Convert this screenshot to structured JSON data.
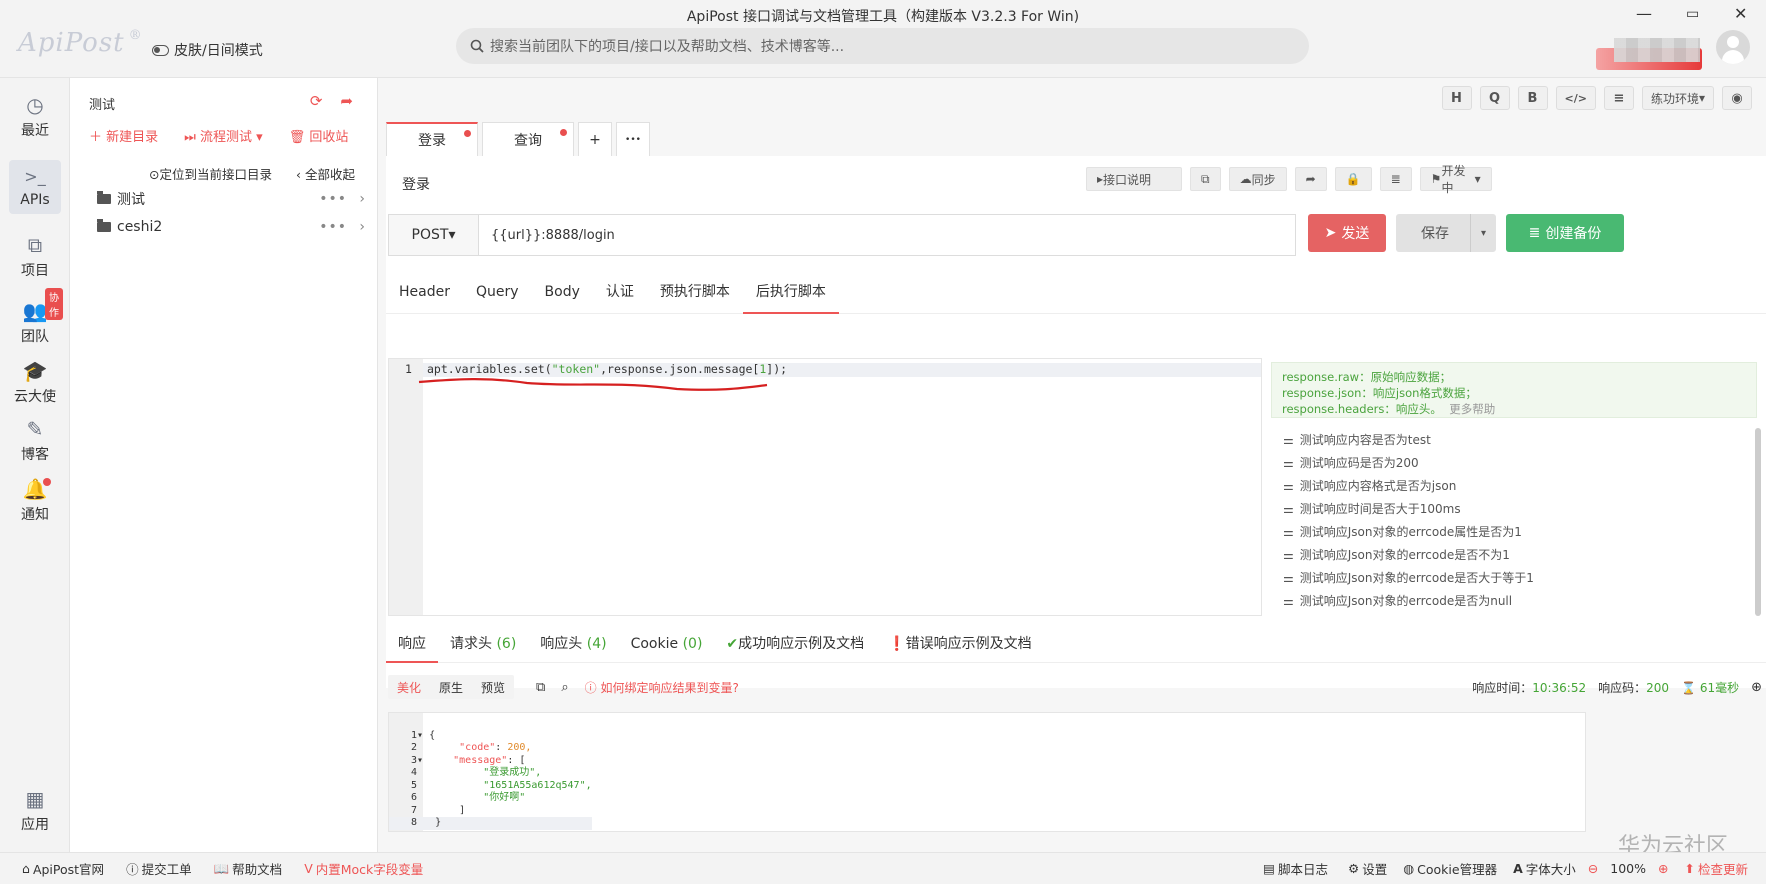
{
  "window": {
    "title": "ApiPost 接口调试与文档管理工具（构建版本 V3.2.3 For Win)"
  },
  "header": {
    "logo": "ApiPost",
    "logo_mark": "®",
    "skin_toggle": "皮肤/日间模式",
    "search_placeholder": "搜索当前团队下的项目/接口以及帮助文档、技术博客等..."
  },
  "nav": [
    {
      "label": "最近",
      "icon": "clock-icon"
    },
    {
      "label": "APIs",
      "icon": "terminal-icon"
    },
    {
      "label": "项目",
      "icon": "project-icon"
    },
    {
      "label": "团队",
      "icon": "team-icon",
      "badge": "协作"
    },
    {
      "label": "云大使",
      "icon": "graduation-cap-icon"
    },
    {
      "label": "博客",
      "icon": "edit-icon"
    },
    {
      "label": "通知",
      "icon": "bell-icon"
    },
    {
      "label": "应用",
      "icon": "apps-grid-icon"
    }
  ],
  "tree": {
    "title": "测试",
    "new_folder": "新建目录",
    "flow_test": "流程测试",
    "recycle": "回收站",
    "locate": "定位到当前接口目录",
    "collapse": "全部收起",
    "folders": [
      "测试",
      "ceshi2"
    ]
  },
  "toolbar": {
    "buttons": [
      "H",
      "Q",
      "B",
      "</>",
      "≡"
    ],
    "env": "练功环境",
    "eye": "👁"
  },
  "tabs": [
    {
      "label": "登录",
      "dirty": true
    },
    {
      "label": "查询",
      "dirty": true
    }
  ],
  "tab_add": "+",
  "tab_more": "•••",
  "api": {
    "name": "登录",
    "doc_btn": "接口说明",
    "sync_btn": "同步",
    "status": "开发中",
    "method": "POST",
    "url": "{{url}}:8888/login",
    "send": "发送",
    "save": "保存",
    "backup": "创建备份"
  },
  "request_tabs": [
    "Header",
    "Query",
    "Body",
    "认证",
    "预执行脚本",
    "后执行脚本"
  ],
  "script": {
    "line_no": "1",
    "code_prefix": "apt.variables.set(",
    "code_str": "\"token\"",
    "code_mid": ",response.json.message[",
    "code_num": "1",
    "code_end": "]);"
  },
  "hints": {
    "line1": "response.raw：原始响应数据；",
    "line2": "response.json：响应json格式数据；",
    "line3": "response.headers：响应头。",
    "more": "更多帮助"
  },
  "snippets": [
    "测试响应内容是否为test",
    "测试响应码是否为200",
    "测试响应内容格式是否为json",
    "测试响应时间是否大于100ms",
    "测试响应Json对象的errcode属性是否为1",
    "测试响应Json对象的errcode是否不为1",
    "测试响应Json对象的errcode是否大于等于1",
    "测试响应Json对象的errcode是否为null"
  ],
  "response_tabs": [
    {
      "label": "响应",
      "count": ""
    },
    {
      "label": "请求头",
      "count": "(6)"
    },
    {
      "label": "响应头",
      "count": "(4)"
    },
    {
      "label": "Cookie",
      "count": "(0)"
    },
    {
      "label": "成功响应示例及文档",
      "count": ""
    },
    {
      "label": "错误响应示例及文档",
      "count": ""
    }
  ],
  "response_bar": {
    "modes": [
      "美化",
      "原生",
      "预览"
    ],
    "bind_help": "如何绑定响应结果到变量?",
    "time_label": "响应时间：",
    "time_value": "10:36:52",
    "code_label": "响应码：",
    "code_value": "200",
    "duration": "61毫秒"
  },
  "response_body": {
    "lines": [
      {
        "n": "1",
        "fold": "▾",
        "text": "{"
      },
      {
        "n": "2",
        "fold": "",
        "key": "\"code\"",
        "val": "200,"
      },
      {
        "n": "3",
        "fold": "▾",
        "key": "\"message\"",
        "val": "["
      },
      {
        "n": "4",
        "fold": "",
        "str": "\"登录成功\","
      },
      {
        "n": "5",
        "fold": "",
        "str": "\"1651A55a612q547\","
      },
      {
        "n": "6",
        "fold": "",
        "str": "\"你好啊\""
      },
      {
        "n": "7",
        "fold": "",
        "text": "    ]"
      },
      {
        "n": "8",
        "fold": "",
        "text": "}"
      }
    ]
  },
  "statusbar": {
    "site": "ApiPost官网",
    "ticket": "提交工单",
    "help": "帮助文档",
    "mock": "内置Mock字段变量",
    "log": "脚本日志",
    "settings": "设置",
    "cookie": "Cookie管理器",
    "font": "字体大小",
    "zoom": "100%",
    "update": "检查更新"
  },
  "watermark": "华为云社区"
}
